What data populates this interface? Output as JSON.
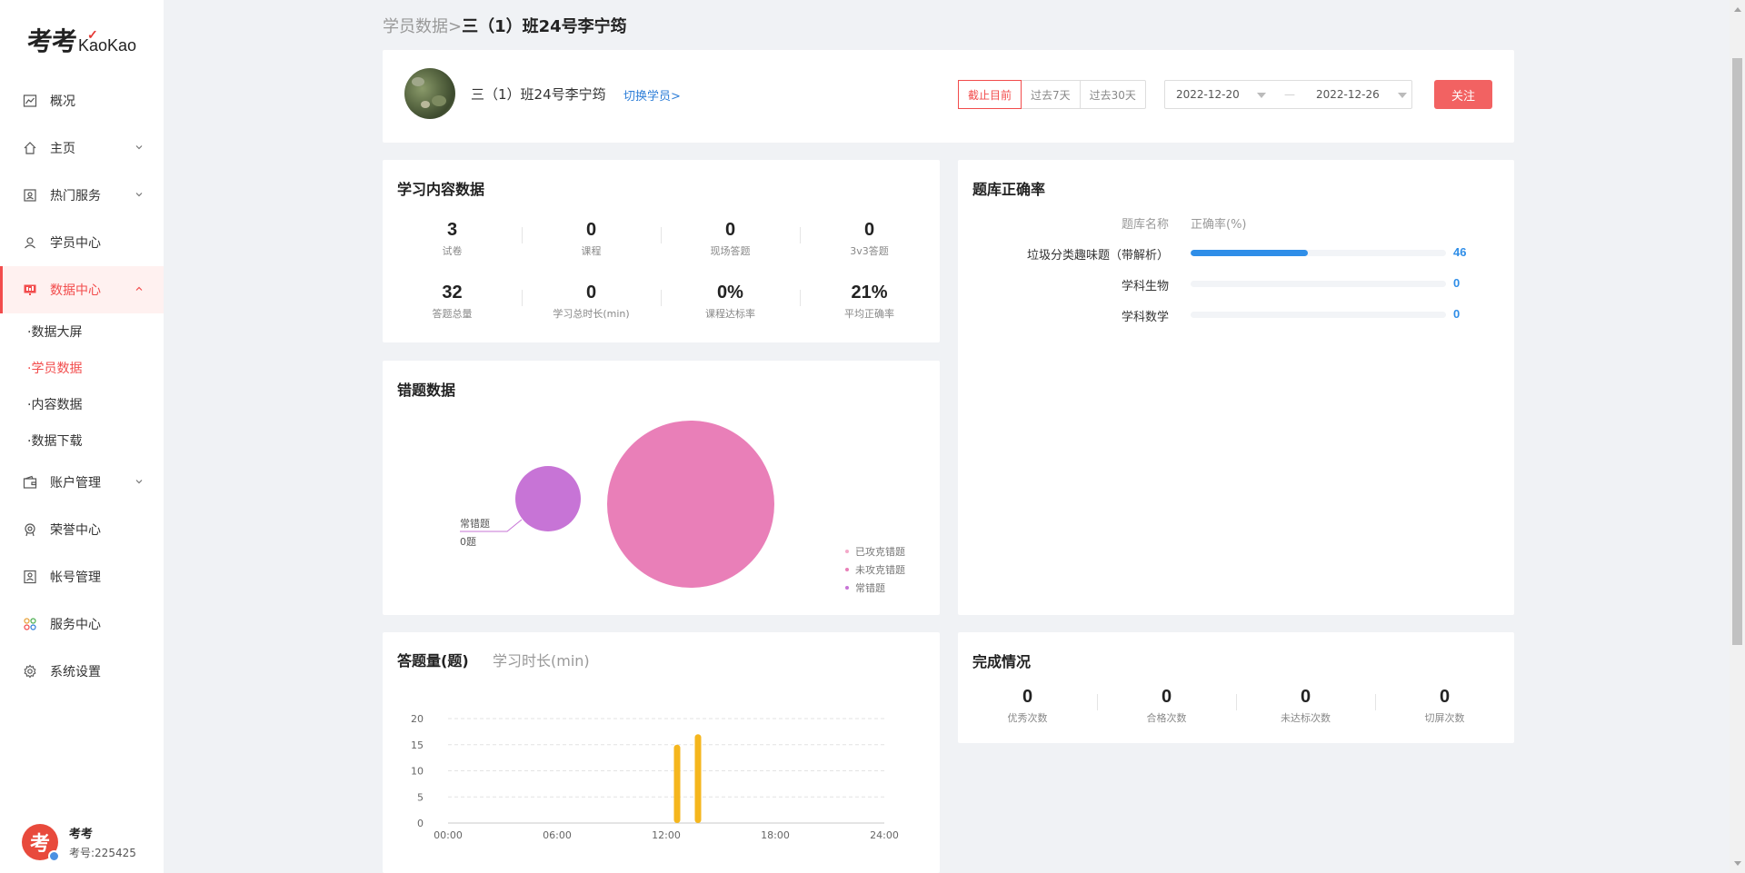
{
  "brand": {
    "logo_cn": "考考",
    "logo_en": "KaoKao"
  },
  "sidebar": {
    "items": [
      {
        "label": "概况",
        "icon": "chart-icon"
      },
      {
        "label": "主页",
        "icon": "home-icon",
        "expandable": true
      },
      {
        "label": "热门服务",
        "icon": "service-icon",
        "expandable": true
      },
      {
        "label": "学员中心",
        "icon": "users-icon"
      },
      {
        "label": "数据中心",
        "icon": "monitor-icon",
        "expandable": true,
        "active": true
      },
      {
        "label": "账户管理",
        "icon": "wallet-icon",
        "expandable": true
      },
      {
        "label": "荣誉中心",
        "icon": "medal-icon"
      },
      {
        "label": "帐号管理",
        "icon": "account-icon"
      },
      {
        "label": "服务中心",
        "icon": "apps-icon"
      },
      {
        "label": "系统设置",
        "icon": "gear-icon"
      }
    ],
    "sub_items": [
      "·数据大屏",
      "·学员数据",
      "·内容数据",
      "·数据下载"
    ],
    "active_sub": 1
  },
  "user": {
    "name": "考考",
    "id": "考号:225425",
    "avatar_text": "考"
  },
  "breadcrumb": {
    "parent": "学员数据>",
    "current": "三（1）班24号李宁筠"
  },
  "header": {
    "student_name": "三（1）班24号李宁筠",
    "switch_label": "切换学员>",
    "ranges": [
      "截止目前",
      "过去7天",
      "过去30天"
    ],
    "active_range": 0,
    "date_start": "2022-12-20",
    "date_sep": "—",
    "date_end": "2022-12-26",
    "follow_label": "关注"
  },
  "learning": {
    "title": "学习内容数据",
    "stats": [
      {
        "value": "3",
        "label": "试卷"
      },
      {
        "value": "0",
        "label": "课程"
      },
      {
        "value": "0",
        "label": "现场答题"
      },
      {
        "value": "0",
        "label": "3v3答题"
      },
      {
        "value": "32",
        "label": "答题总量"
      },
      {
        "value": "0",
        "label": "学习总时长(min)"
      },
      {
        "value": "0%",
        "label": "课程达标率"
      },
      {
        "value": "21%",
        "label": "平均正确率"
      }
    ]
  },
  "accuracy": {
    "title": "题库正确率",
    "col_name": "题库名称",
    "col_rate": "正确率(%)",
    "rows": [
      {
        "name": "垃圾分类趣味题（带解析）",
        "value": 46,
        "display": "46"
      },
      {
        "name": "学科生物",
        "value": 0,
        "display": "0"
      },
      {
        "name": "学科数学",
        "value": 0,
        "display": "0"
      }
    ],
    "bar_color": "#2f8ee8"
  },
  "wrong": {
    "title": "错题数据",
    "bubble_label": "常错题",
    "bubble_value": "0题",
    "legend": [
      {
        "name": "已攻克错题",
        "color": "#f4a9c9"
      },
      {
        "name": "未攻克错题",
        "color": "#e97fb8"
      },
      {
        "name": "常错题",
        "color": "#c774d6"
      }
    ]
  },
  "answers": {
    "tab_active": "答题量(题)",
    "tab_inactive": "学习时长(min)"
  },
  "chart_data": {
    "type": "bar",
    "x": [
      "12:30",
      "13:45"
    ],
    "values": [
      15,
      17
    ],
    "xticks": [
      "00:00",
      "06:00",
      "12:00",
      "18:00",
      "24:00"
    ],
    "yticks": [
      "0",
      "5",
      "10",
      "15",
      "20"
    ],
    "ylim": [
      0,
      20
    ],
    "xlim_hours": [
      0,
      24
    ],
    "bar_hours": [
      12.6,
      13.75
    ],
    "color": "#f5b61d",
    "grid": true
  },
  "completion": {
    "title": "完成情况",
    "stats": [
      {
        "value": "0",
        "label": "优秀次数"
      },
      {
        "value": "0",
        "label": "合格次数"
      },
      {
        "value": "0",
        "label": "未达标次数"
      },
      {
        "value": "0",
        "label": "切屏次数"
      }
    ]
  },
  "colors": {
    "accent": "#f24c4c",
    "link": "#2f7fd8"
  }
}
